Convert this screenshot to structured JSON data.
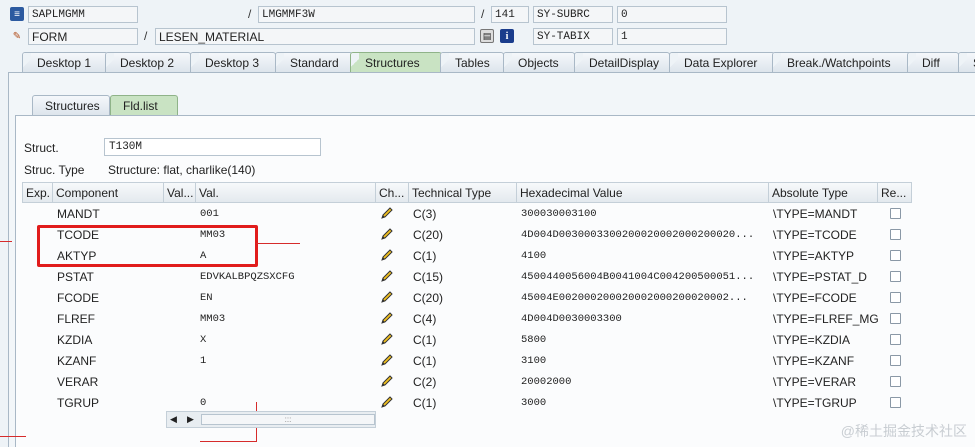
{
  "top": {
    "row1": {
      "program": "SAPLMGMM",
      "sep1": "/",
      "include": "LMGMMF3W",
      "sep2": "/",
      "line": "141",
      "sysvar": "SY-SUBRC",
      "sysval": "0"
    },
    "row2": {
      "event_type": "FORM",
      "sep1": "/",
      "event": "LESEN_MATERIAL",
      "sysvar": "SY-TABIX",
      "sysval": "1"
    }
  },
  "tabs": [
    "Desktop 1",
    "Desktop 2",
    "Desktop 3",
    "Standard",
    "Structures",
    "Tables",
    "Objects",
    "DetailDisplay",
    "Data Explorer",
    "Break./Watchpoints",
    "Diff",
    "S"
  ],
  "active_tab": "Structures",
  "inner_tabs": [
    "Structures",
    "Fld.list"
  ],
  "active_inner_tab": "Fld.list",
  "struct": {
    "label": "Struct.",
    "value": "T130M",
    "type_label": "Struc. Type",
    "type_value": "Structure: flat, charlike(140)"
  },
  "grid": {
    "headers": [
      "Exp.",
      "Component",
      "Val...",
      "Val.",
      "Ch...",
      "Technical Type",
      "Hexadecimal Value",
      "Absolute Type",
      "Re..."
    ],
    "rows": [
      {
        "component": "MANDT",
        "val": "001",
        "tech": "C(3)",
        "hex": "300030003100",
        "abs": "\\TYPE=MANDT"
      },
      {
        "component": "TCODE",
        "val": "MM03",
        "tech": "C(20)",
        "hex": "4D004D0030003300200020002000200020...",
        "abs": "\\TYPE=TCODE"
      },
      {
        "component": "AKTYP",
        "val": "A",
        "tech": "C(1)",
        "hex": "4100",
        "abs": "\\TYPE=AKTYP"
      },
      {
        "component": "PSTAT",
        "val": "EDVKALBPQZSXCFG",
        "tech": "C(15)",
        "hex": "4500440056004B0041004C004200500051...",
        "abs": "\\TYPE=PSTAT_D"
      },
      {
        "component": "FCODE",
        "val": "EN",
        "tech": "C(20)",
        "hex": "45004E002000200020002000200020002...",
        "abs": "\\TYPE=FCODE"
      },
      {
        "component": "FLREF",
        "val": "MM03",
        "tech": "C(4)",
        "hex": "4D004D0030003300",
        "abs": "\\TYPE=FLREF_MG"
      },
      {
        "component": "KZDIA",
        "val": "X",
        "tech": "C(1)",
        "hex": "5800",
        "abs": "\\TYPE=KZDIA"
      },
      {
        "component": "KZANF",
        "val": "1",
        "tech": "C(1)",
        "hex": "3100",
        "abs": "\\TYPE=KZANF"
      },
      {
        "component": "VERAR",
        "val": "",
        "tech": "C(2)",
        "hex": "20002000",
        "abs": "\\TYPE=VERAR"
      },
      {
        "component": "TGRUP",
        "val": "0",
        "tech": "C(1)",
        "hex": "3000",
        "abs": "\\TYPE=TGRUP"
      }
    ]
  },
  "watermark": "@稀土掘金技术社区",
  "colors": {
    "active_tab": "#c9e3c3",
    "highlight": "#e11c1c"
  }
}
